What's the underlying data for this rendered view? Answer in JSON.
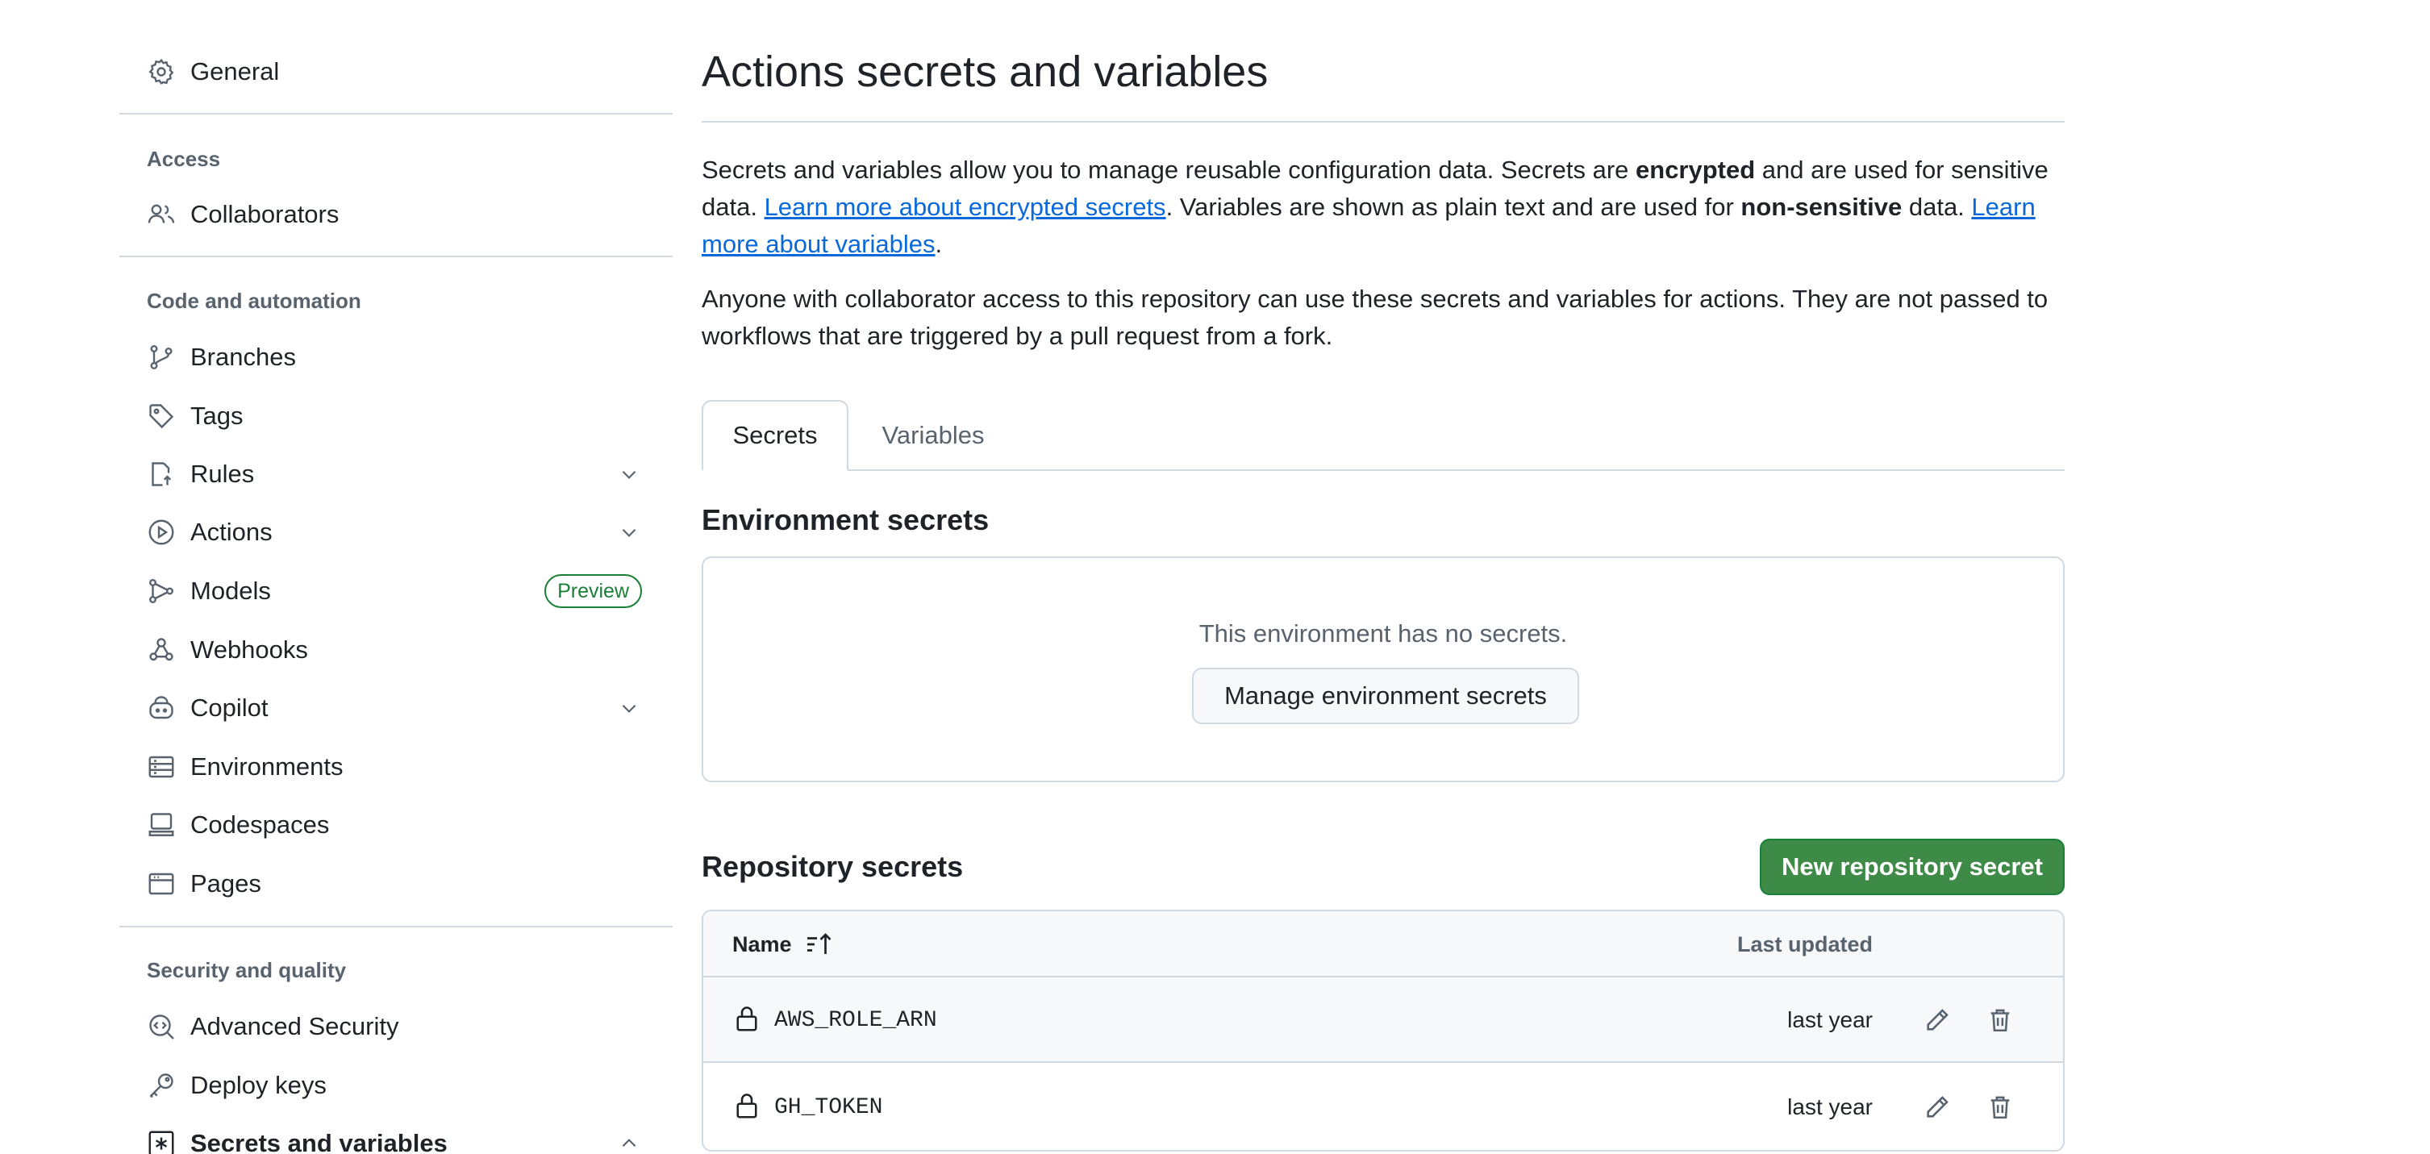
{
  "sidebar": {
    "general": "General",
    "sections": {
      "access": "Access",
      "code_automation": "Code and automation",
      "security_quality": "Security and quality"
    },
    "items": {
      "collaborators": "Collaborators",
      "branches": "Branches",
      "tags": "Tags",
      "rules": "Rules",
      "actions": "Actions",
      "models": "Models",
      "models_badge": "Preview",
      "webhooks": "Webhooks",
      "copilot": "Copilot",
      "environments": "Environments",
      "codespaces": "Codespaces",
      "pages": "Pages",
      "advanced_security": "Advanced Security",
      "deploy_keys": "Deploy keys",
      "secrets_variables": "Secrets and variables"
    }
  },
  "main": {
    "title": "Actions secrets and variables",
    "intro": {
      "p1_a": "Secrets and variables allow you to manage reusable configuration data. Secrets are ",
      "p1_b": "encrypted",
      "p1_c": " and are used for sensitive data. ",
      "p1_link1": "Learn more about encrypted secrets",
      "p1_d": ". Variables are shown as plain text and are used for ",
      "p1_e": "non-sensitive",
      "p1_f": " data. ",
      "p1_link2": "Learn more about variables",
      "p1_g": ".",
      "p2": "Anyone with collaborator access to this repository can use these secrets and variables for actions. They are not passed to workflows that are triggered by a pull request from a fork."
    },
    "tabs": {
      "secrets": "Secrets",
      "variables": "Variables"
    },
    "env_secrets": {
      "heading": "Environment secrets",
      "empty_text": "This environment has no secrets.",
      "manage_button": "Manage environment secrets"
    },
    "repo_secrets": {
      "heading": "Repository secrets",
      "new_button": "New repository secret",
      "columns": {
        "name": "Name",
        "last_updated": "Last updated"
      },
      "rows": [
        {
          "name": "AWS_ROLE_ARN",
          "updated": "last year"
        },
        {
          "name": "GH_TOKEN",
          "updated": "last year"
        }
      ]
    }
  },
  "colors": {
    "accent_link": "#0969da",
    "primary_button": "#3e8a47",
    "preview_badge": "#1a7f37",
    "muted_text": "#59636e",
    "border": "#d1d9e0"
  }
}
